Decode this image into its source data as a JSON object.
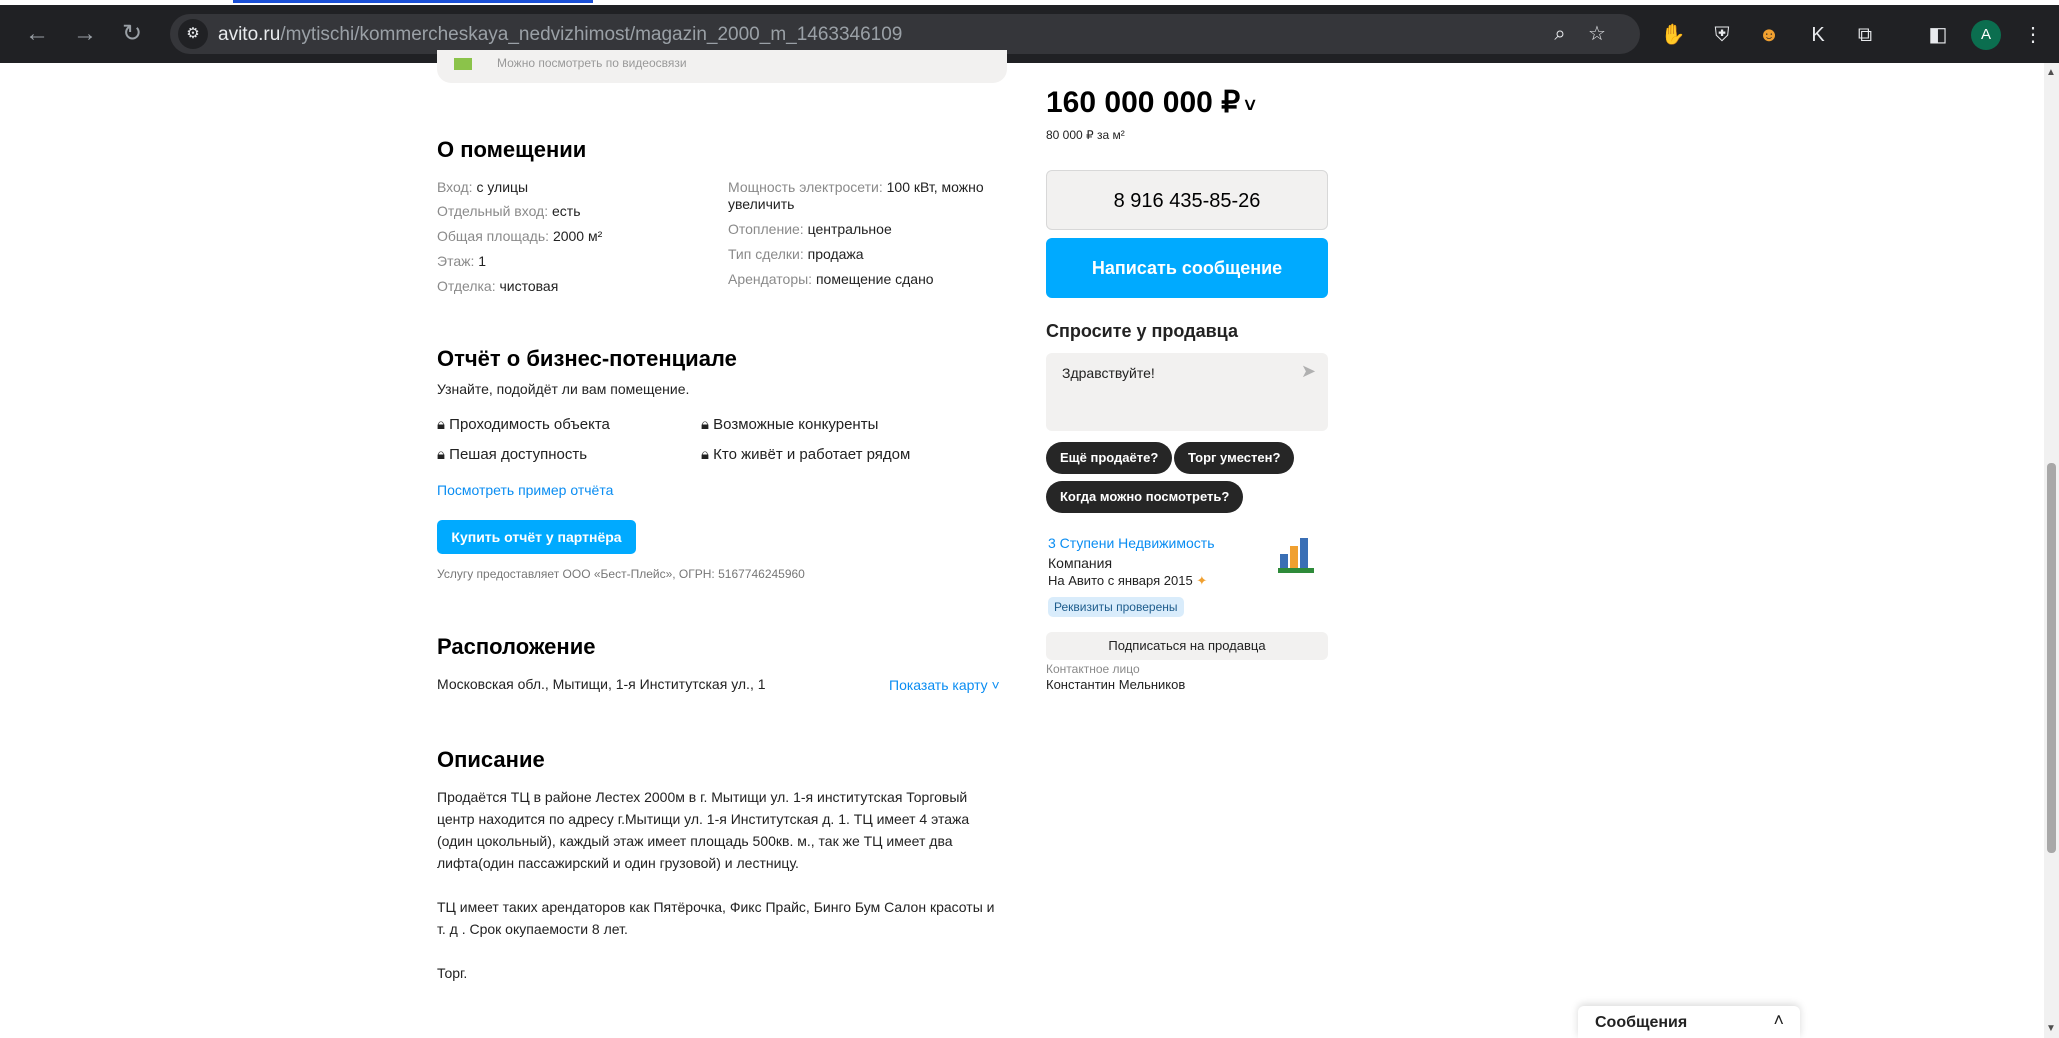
{
  "browser": {
    "url_host": "avito.ru",
    "url_path": "/mytischi/kommercheskaya_nedvizhimost/magazin_2000_m_1463346109",
    "avatar_letter": "A",
    "extension_letter": "K"
  },
  "prev_block_text": "Можно посмотреть по видеосвязи",
  "about": {
    "title": "О помещении",
    "left": [
      {
        "label": "Вход:",
        "value": "с улицы"
      },
      {
        "label": "Отдельный вход:",
        "value": "есть"
      },
      {
        "label": "Общая площадь:",
        "value": "2000 м²"
      },
      {
        "label": "Этаж:",
        "value": "1"
      },
      {
        "label": "Отделка:",
        "value": "чистовая"
      }
    ],
    "right": [
      {
        "label": "Мощность электросети:",
        "value": "100 кВт, можно увеличить"
      },
      {
        "label": "Отопление:",
        "value": "центральное"
      },
      {
        "label": "Тип сделки:",
        "value": "продажа"
      },
      {
        "label": "Арендаторы:",
        "value": "помещение сдано"
      }
    ]
  },
  "report": {
    "title": "Отчёт о бизнес-потенциале",
    "subtitle": "Узнайте, подойдёт ли вам помещение.",
    "items": [
      "Проходимость объекта",
      "Возможные конкуренты",
      "Пешая доступность",
      "Кто живёт и работает рядом"
    ],
    "example_link": "Посмотреть пример отчёта",
    "buy_button": "Купить отчёт у партнёра",
    "provider": "Услугу предоставляет ООО «Бест-Плейс», ОГРН: 5167746245960"
  },
  "location": {
    "title": "Расположение",
    "address": "Московская обл., Мытищи, 1-я Институтская ул., 1",
    "map_link": "Показать карту"
  },
  "description": {
    "title": "Описание",
    "p1": "Продаётся ТЦ в районе Лестех 2000м в г. Мытищи ул. 1-я институтская Торговый центр находится по адресу г.Мытищи ул. 1-я Институтская д. 1. ТЦ имеет 4 этажа (один цокольный), каждый этаж имеет площадь 500кв. м., так же ТЦ имеет два лифта(один пассажирский и один грузовой) и лестницу.",
    "p2": "ТЦ имеет таких арендаторов как Пятёрочка, Фикс Прайс, Бинго Бум Салон красоты и т. д . Срок окупаемости 8 лет.",
    "p3": "Торг."
  },
  "sidebar": {
    "price": "160 000 000 ₽",
    "price_per_sqm": "80 000 ₽ за м²",
    "phone": "8 916 435-85-26",
    "write_button": "Написать сообщение",
    "ask_title": "Спросите у продавца",
    "ask_message": "Здравствуйте!",
    "chips": [
      "Ещё продаёте?",
      "Торг уместен?",
      "Когда можно посмотреть?"
    ],
    "seller_name": "3 Ступени Недвижимость",
    "seller_type": "Компания",
    "seller_since": "На Авито с января 2015",
    "verified_badge": "Реквизиты проверены",
    "subscribe": "Подписаться на продавца",
    "contact_label": "Контактное лицо",
    "contact_name": "Константин Мельников"
  },
  "messages_panel": {
    "title": "Сообщения"
  },
  "colors": {
    "accent_blue": "#00aaff",
    "link_blue": "#0a8df2",
    "chip_dark": "#262626",
    "panel_grey": "#f2f1f0"
  }
}
